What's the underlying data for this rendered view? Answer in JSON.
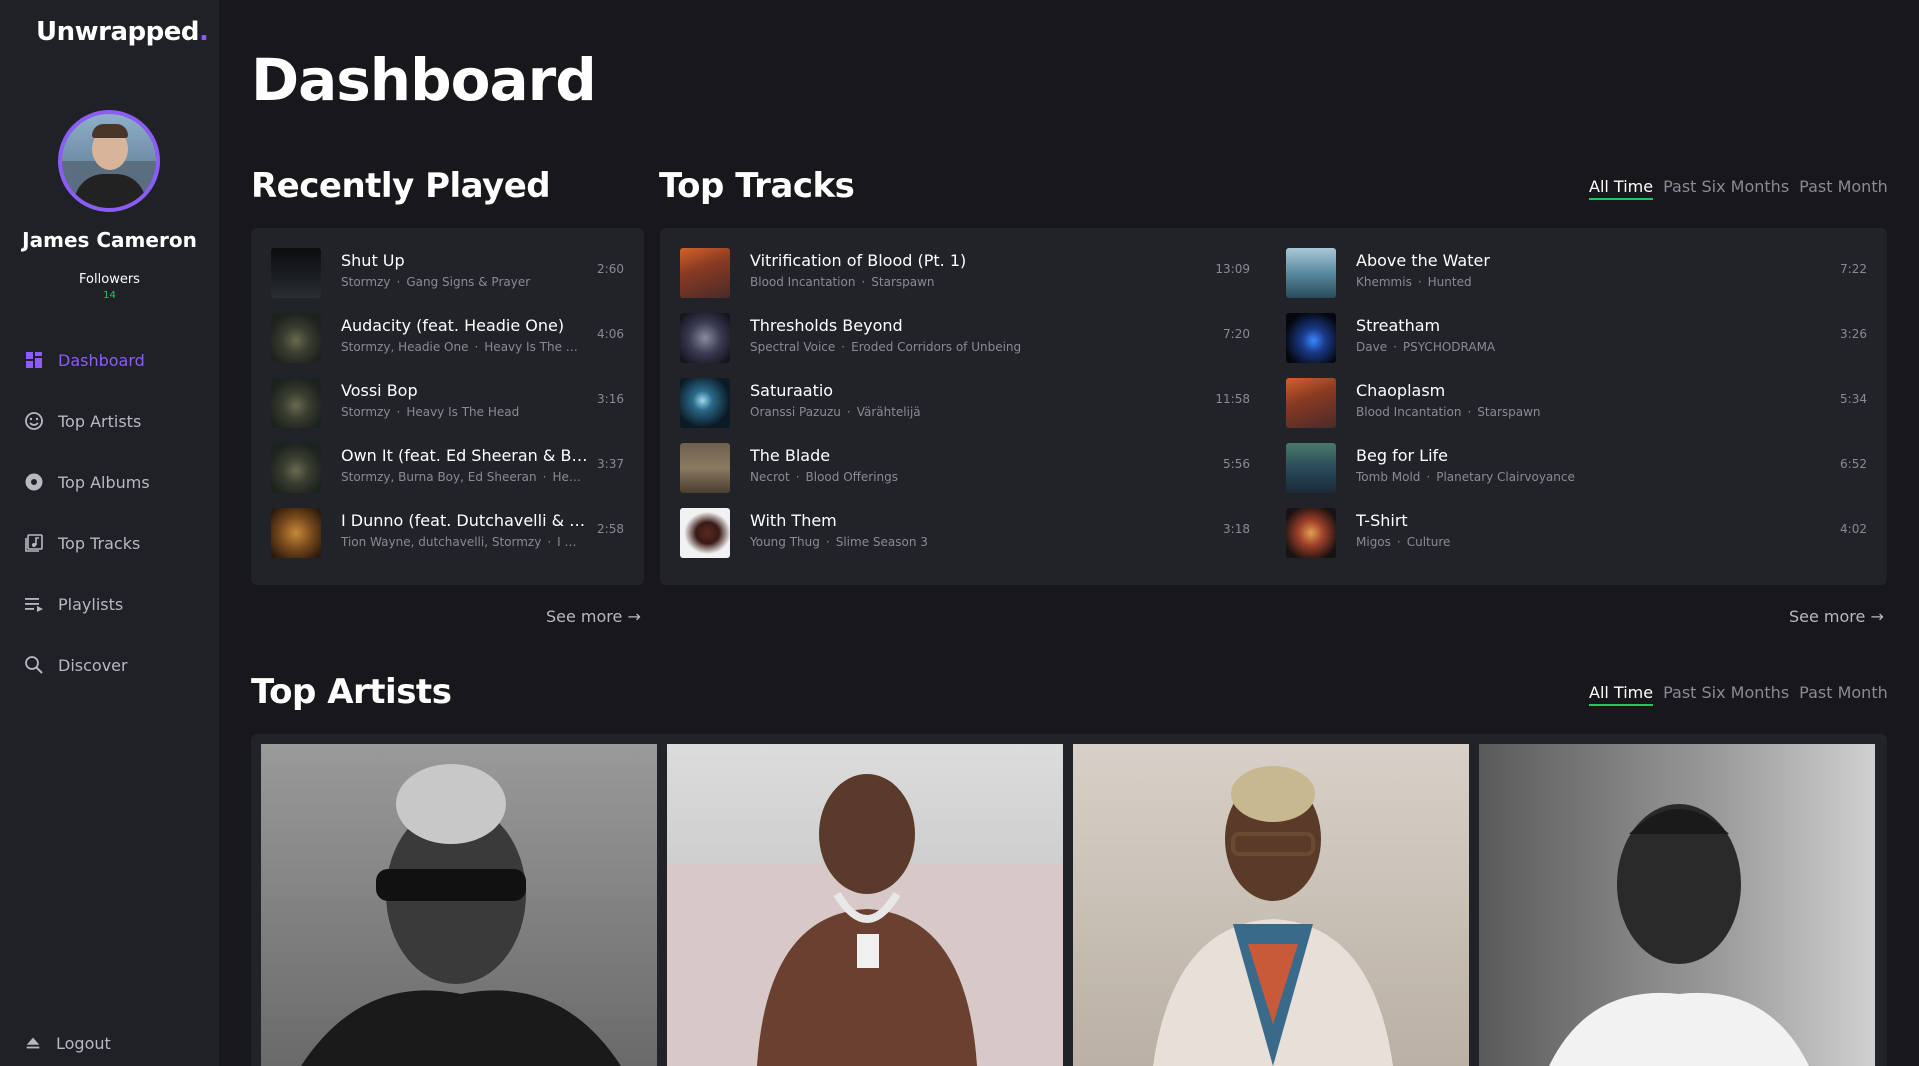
{
  "brand": {
    "name": "Unwrapped",
    "dot": "."
  },
  "user": {
    "name": "James Cameron",
    "followers_label": "Followers",
    "followers_count": "14"
  },
  "nav": [
    {
      "label": "Dashboard",
      "icon": "dashboard-grid-icon",
      "active": true
    },
    {
      "label": "Top Artists",
      "icon": "smiley-icon",
      "active": false
    },
    {
      "label": "Top Albums",
      "icon": "disc-icon",
      "active": false
    },
    {
      "label": "Top Tracks",
      "icon": "music-note-icon",
      "active": false
    },
    {
      "label": "Playlists",
      "icon": "playlist-icon",
      "active": false
    },
    {
      "label": "Discover",
      "icon": "search-icon",
      "active": false
    }
  ],
  "logout": {
    "label": "Logout",
    "icon": "eject-icon"
  },
  "page": {
    "title": "Dashboard"
  },
  "recently_played": {
    "title": "Recently Played",
    "see_more": "See more →",
    "tracks": [
      {
        "title": "Shut Up",
        "artist": "Stormzy",
        "album": "Gang Signs & Prayer",
        "duration": "2:60"
      },
      {
        "title": "Audacity (feat. Headie One)",
        "artist": "Stormzy, Headie One",
        "album": "Heavy Is The He...",
        "duration": "4:06"
      },
      {
        "title": "Vossi Bop",
        "artist": "Stormzy",
        "album": "Heavy Is The Head",
        "duration": "3:16"
      },
      {
        "title": "Own It (feat. Ed Sheeran & Bur...",
        "artist": "Stormzy, Burna Boy, Ed Sheeran",
        "album": "Heav...",
        "duration": "3:37"
      },
      {
        "title": "I Dunno (feat. Dutchavelli & St...",
        "artist": "Tion Wayne, dutchavelli, Stormzy",
        "album": "I Du...",
        "duration": "2:58"
      }
    ]
  },
  "top_tracks": {
    "title": "Top Tracks",
    "filters": [
      "All Time",
      "Past Six Months",
      "Past Month"
    ],
    "see_more": "See more →",
    "left": [
      {
        "title": "Vitrification of Blood (Pt. 1)",
        "artist": "Blood Incantation",
        "album": "Starspawn",
        "duration": "13:09"
      },
      {
        "title": "Thresholds Beyond",
        "artist": "Spectral Voice",
        "album": "Eroded Corridors of Unbeing",
        "duration": "7:20"
      },
      {
        "title": "Saturaatio",
        "artist": "Oranssi Pazuzu",
        "album": "Värähtelijä",
        "duration": "11:58"
      },
      {
        "title": "The Blade",
        "artist": "Necrot",
        "album": "Blood Offerings",
        "duration": "5:56"
      },
      {
        "title": "With Them",
        "artist": "Young Thug",
        "album": "Slime Season 3",
        "duration": "3:18"
      }
    ],
    "right": [
      {
        "title": "Above the Water",
        "artist": "Khemmis",
        "album": "Hunted",
        "duration": "7:22"
      },
      {
        "title": "Streatham",
        "artist": "Dave",
        "album": "PSYCHODRAMA",
        "duration": "3:26"
      },
      {
        "title": "Chaoplasm",
        "artist": "Blood Incantation",
        "album": "Starspawn",
        "duration": "5:34"
      },
      {
        "title": "Beg for Life",
        "artist": "Tomb Mold",
        "album": "Planetary Clairvoyance",
        "duration": "6:52"
      },
      {
        "title": "T-Shirt",
        "artist": "Migos",
        "album": "Culture",
        "duration": "4:02"
      }
    ]
  },
  "top_artists": {
    "title": "Top Artists",
    "filters": [
      "All Time",
      "Past Six Months",
      "Past Month"
    ]
  },
  "colors": {
    "accent": "#8b5cf6",
    "active_underline": "#22c55e",
    "background": "#17171c",
    "sidebar": "#202127",
    "panel": "#222329"
  }
}
